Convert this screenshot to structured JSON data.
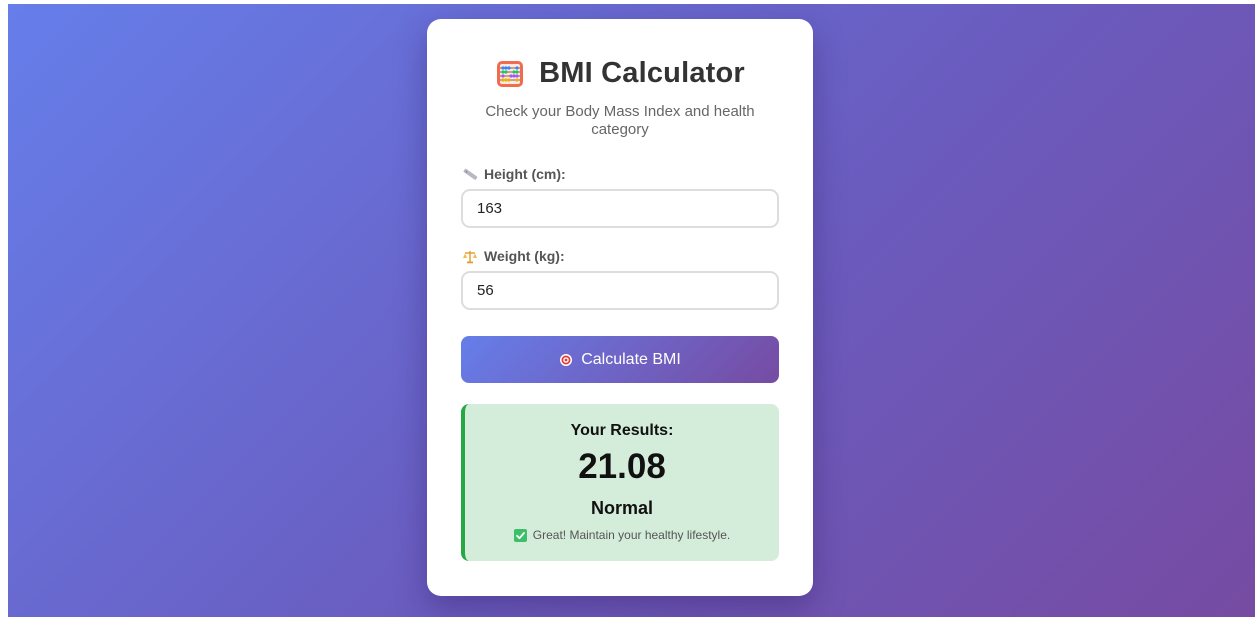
{
  "app": {
    "title": "BMI Calculator",
    "subtitle": "Check your Body Mass Index and health category",
    "title_icon": "abacus-icon"
  },
  "form": {
    "height": {
      "label": "Height (cm):",
      "value": "163",
      "icon": "ruler-icon"
    },
    "weight": {
      "label": "Weight (kg):",
      "value": "56",
      "icon": "scale-icon"
    },
    "calculate_button": {
      "label": "Calculate BMI",
      "icon": "target-icon"
    }
  },
  "results": {
    "heading": "Your Results:",
    "bmi": "21.08",
    "category": "Normal",
    "advice": "Great! Maintain your healthy lifestyle.",
    "advice_icon": "check-icon"
  },
  "colors": {
    "gradient_start": "#667eea",
    "gradient_end": "#764ba2",
    "result_background": "#d4edda",
    "result_accent": "#28a745"
  }
}
